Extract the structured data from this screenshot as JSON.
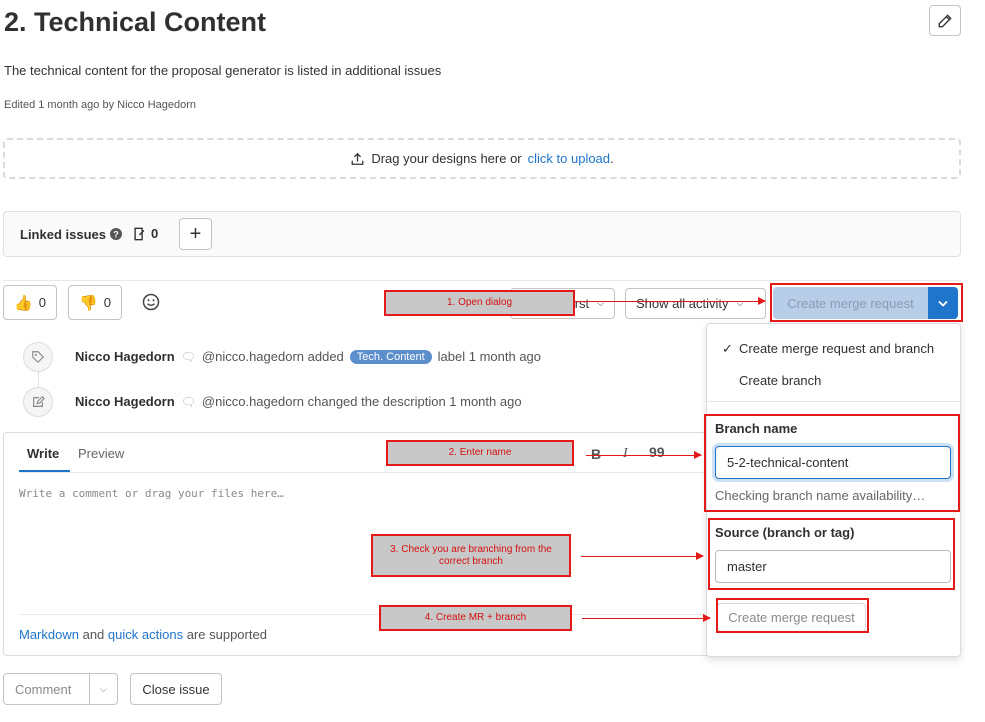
{
  "issue": {
    "title": "2. Technical Content",
    "description": "The technical content for the proposal generator is listed in additional issues",
    "edited": "Edited 1 month ago by Nicco Hagedorn"
  },
  "dropzone": {
    "text": "Drag your designs here or",
    "link": "click to upload",
    "suffix": "."
  },
  "linked_issues": {
    "label": "Linked issues",
    "count": "0"
  },
  "votes": {
    "thumbs_up": "0",
    "thumbs_down": "0"
  },
  "toolbar": {
    "sort_label": "rst",
    "activity_filter": "Show all activity",
    "create_mr_label": "Create merge request"
  },
  "activity": [
    {
      "author": "Nicco Hagedorn",
      "handle": "@nicco.hagedorn added",
      "label": "Tech. Content",
      "suffix": "label 1 month ago"
    },
    {
      "author": "Nicco Hagedorn",
      "handle": "@nicco.hagedorn changed the description 1 month ago"
    }
  ],
  "editor": {
    "tab_write": "Write",
    "tab_preview": "Preview",
    "bold": "B",
    "italic": "I",
    "quote": "99",
    "placeholder": "Write a comment or drag your files here…",
    "footer_link1": "Markdown",
    "footer_and": "and",
    "footer_link2": "quick actions",
    "footer_suffix": "are supported"
  },
  "dropdown": {
    "option1": "Create merge request and branch",
    "option2": "Create branch",
    "branch_label": "Branch name",
    "branch_value": "5-2-technical-content",
    "branch_hint": "Checking branch name availability…",
    "source_label": "Source (branch or tag)",
    "source_value": "master",
    "submit": "Create merge request"
  },
  "buttons": {
    "comment": "Comment",
    "close_issue": "Close issue"
  },
  "annotations": {
    "step1": "1. Open dialog",
    "step2": "2. Enter name",
    "step3": "3. Check you are branching from the correct branch",
    "step4": "4. Create MR + branch"
  },
  "colors": {
    "accent": "#1f75cb",
    "annotation": "#e41a1a",
    "label_badge": "#5b8ecb"
  }
}
